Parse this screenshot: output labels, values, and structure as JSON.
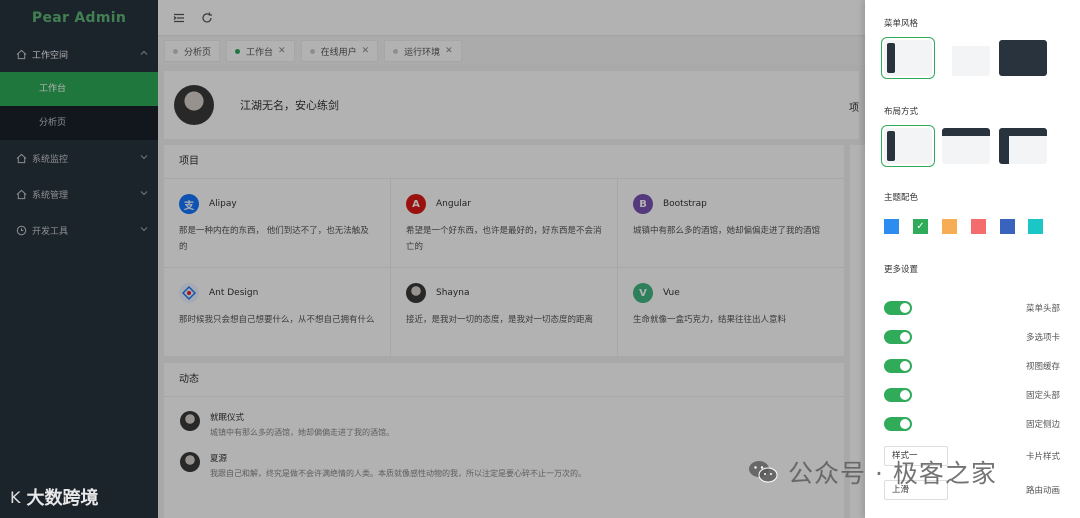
{
  "app": {
    "logo_text": "Pear Admin"
  },
  "sidebar": {
    "items": [
      {
        "label": "工作空间",
        "icon": "home-icon",
        "open": true,
        "children": [
          {
            "label": "工作台",
            "active": true
          },
          {
            "label": "分析页",
            "active": false
          }
        ]
      },
      {
        "label": "系统监控",
        "icon": "home-icon"
      },
      {
        "label": "系统管理",
        "icon": "home-icon"
      },
      {
        "label": "开发工具",
        "icon": "clock-icon"
      }
    ]
  },
  "header": {
    "icons": [
      "menu-toggle-icon",
      "refresh-icon"
    ]
  },
  "tabs": [
    {
      "label": "分析页",
      "active": false
    },
    {
      "label": "工作台",
      "active": true
    },
    {
      "label": "在线用户",
      "active": false
    },
    {
      "label": "运行环境",
      "active": false
    }
  ],
  "welcome": {
    "text": "江湖无名，安心练剑",
    "right_cut": "项"
  },
  "projects": {
    "title": "项目",
    "items": [
      {
        "name": "Alipay",
        "desc": "那是一种内在的东西， 他们到达不了，也无法触及的",
        "color": "#1677ff",
        "glyph": "支"
      },
      {
        "name": "Angular",
        "desc": "希望是一个好东西，也许是最好的，好东西是不会消亡的",
        "color": "#dd1b16",
        "glyph": "A"
      },
      {
        "name": "Bootstrap",
        "desc": "城镇中有那么多的酒馆，她却偏偏走进了我的酒馆",
        "color": "#7952b3",
        "glyph": "B"
      },
      {
        "name": "Ant Design",
        "desc": "那时候我只会想自己想要什么，从不想自己拥有什么",
        "color": "#eef4ff",
        "glyph": ""
      },
      {
        "name": "Shayna",
        "desc": "接近，是我对一切的态度，是我对一切态度的距离",
        "color": "#444444",
        "glyph": ""
      },
      {
        "name": "Vue",
        "desc": "生命就像一盒巧克力，结果往往出人意料",
        "color": "#41b883",
        "glyph": "V"
      }
    ]
  },
  "dynamics": {
    "title": "动态",
    "items": [
      {
        "title": "就眠仪式",
        "desc": "城镇中有那么多的酒馆，她却偏偏走进了我的酒馆。"
      },
      {
        "title": "夏源",
        "desc": "我跟自己和解，终究是做不会许满绝情的人类。本质就像感性动物的我，所以注定是要心碎不止一万次的。"
      }
    ]
  },
  "settings": {
    "menu_style_title": "菜单风格",
    "layout_title": "布局方式",
    "theme_title": "主题配色",
    "more_title": "更多设置",
    "theme_colors": [
      "#2d8cf0",
      "#2fab5a",
      "#f6ad55",
      "#f56c6c",
      "#3963bc",
      "#1bc6c6"
    ],
    "toggles": [
      {
        "label": "菜单头部",
        "on": true
      },
      {
        "label": "多选项卡",
        "on": true
      },
      {
        "label": "视图缓存",
        "on": true
      },
      {
        "label": "固定头部",
        "on": true
      },
      {
        "label": "固定侧边",
        "on": true
      }
    ],
    "selects": [
      {
        "label": "卡片样式",
        "value": "样式一"
      },
      {
        "label": "路由动画",
        "value": "上滑"
      }
    ]
  },
  "watermark": {
    "left_logo": "K",
    "left_text": "大数跨境",
    "right_text": "公众号 · 极客之家"
  }
}
